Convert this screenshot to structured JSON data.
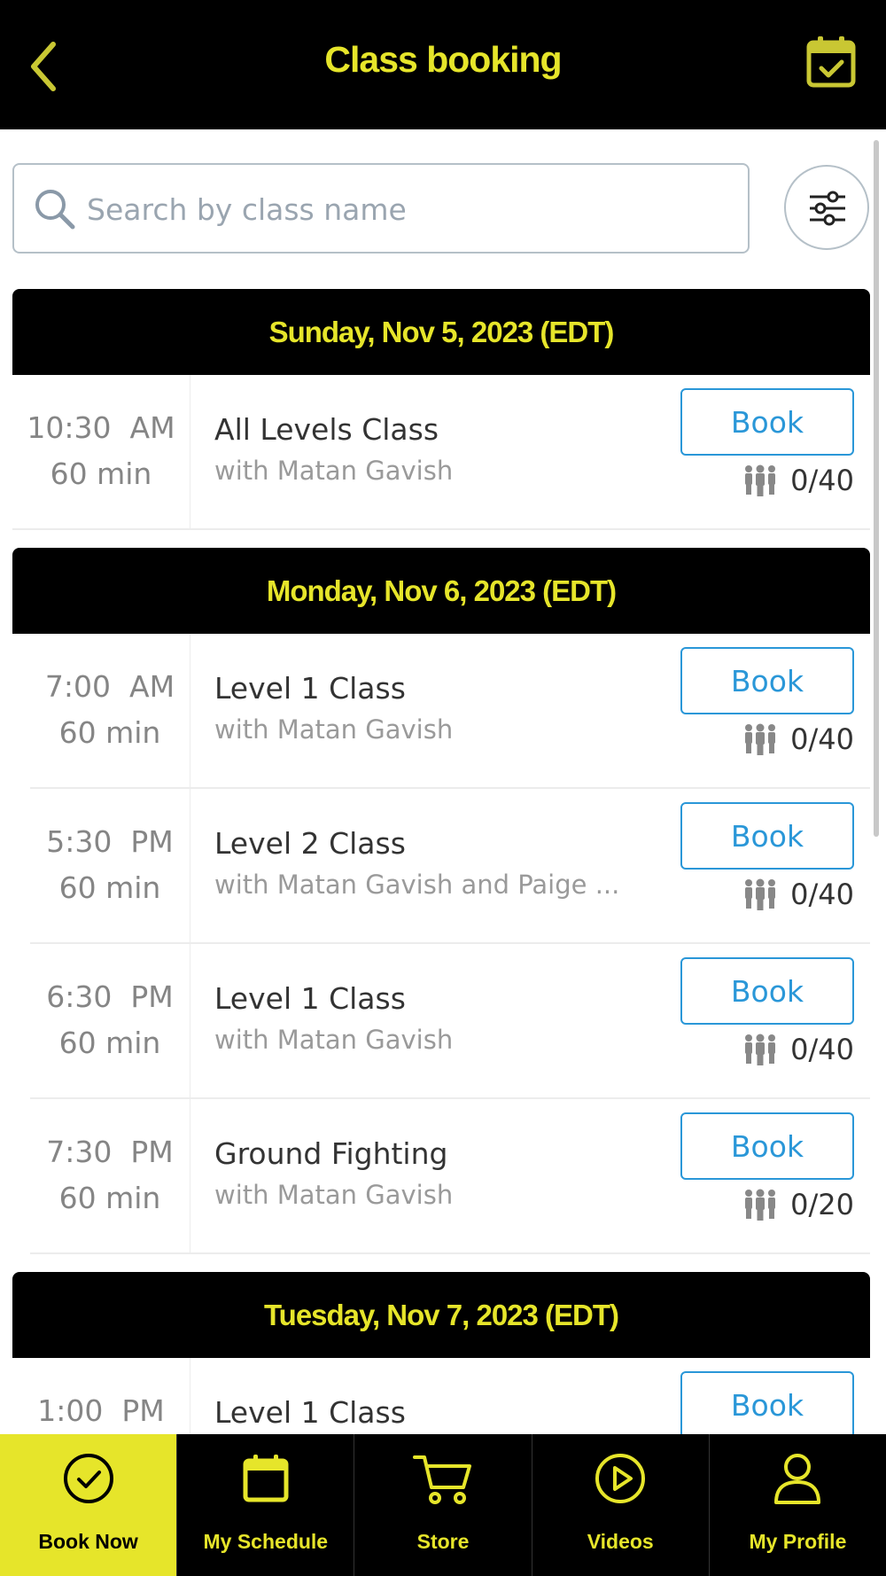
{
  "header": {
    "title": "Class booking",
    "back_icon": "chevron-left-icon",
    "calendar_icon": "calendar-check-icon"
  },
  "search": {
    "placeholder": "Search by class name",
    "value": ""
  },
  "days": [
    {
      "label": "Sunday, Nov 5, 2023 (EDT)",
      "classes": [
        {
          "time": "10:30  AM",
          "duration": "60 min",
          "name": "All Levels Class",
          "instructor": "with Matan Gavish",
          "book": "Book",
          "capacity": "0/40"
        }
      ]
    },
    {
      "label": "Monday, Nov 6, 2023 (EDT)",
      "classes": [
        {
          "time": "7:00  AM",
          "duration": "60 min",
          "name": "Level 1 Class",
          "instructor": "with Matan Gavish",
          "book": "Book",
          "capacity": "0/40"
        },
        {
          "time": "5:30  PM",
          "duration": "60 min",
          "name": "Level 2 Class",
          "instructor": "with Matan Gavish and Paige ...",
          "book": "Book",
          "capacity": "0/40"
        },
        {
          "time": "6:30  PM",
          "duration": "60 min",
          "name": "Level 1 Class",
          "instructor": "with Matan Gavish",
          "book": "Book",
          "capacity": "0/40"
        },
        {
          "time": "7:30  PM",
          "duration": "60 min",
          "name": "Ground Fighting",
          "instructor": "with Matan Gavish",
          "book": "Book",
          "capacity": "0/20"
        }
      ]
    },
    {
      "label": "Tuesday, Nov 7, 2023 (EDT)",
      "classes": [
        {
          "time": "1:00  PM",
          "name": "Level 1 Class",
          "book": "Book"
        }
      ]
    }
  ],
  "nav": [
    {
      "label": "Book Now",
      "icon": "check-circle-icon",
      "active": true
    },
    {
      "label": "My Schedule",
      "icon": "calendar-icon",
      "active": false
    },
    {
      "label": "Store",
      "icon": "cart-icon",
      "active": false
    },
    {
      "label": "Videos",
      "icon": "play-circle-icon",
      "active": false
    },
    {
      "label": "My Profile",
      "icon": "user-icon",
      "active": false
    }
  ],
  "colors": {
    "accent": "#e6e52a",
    "header_bg": "#000000",
    "link": "#2a97d8"
  }
}
